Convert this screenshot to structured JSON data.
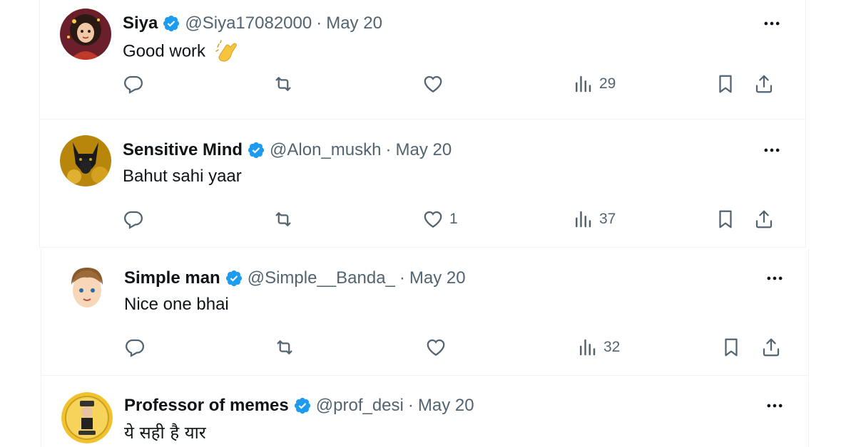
{
  "replies": [
    {
      "name": "Siya",
      "handle": "@Siya17082000",
      "separator": "·",
      "date": "May 20",
      "text": "Good work",
      "emoji": "clapping-hands",
      "likes": "",
      "views": "29"
    },
    {
      "name": "Sensitive Mind",
      "handle": "@Alon_muskh",
      "separator": "·",
      "date": "May 20",
      "text": "Bahut sahi yaar",
      "likes": "1",
      "views": "37"
    },
    {
      "name": "Simple man",
      "handle": "@Simple__Banda_",
      "separator": "·",
      "date": "May 20",
      "text": "Nice one bhai",
      "likes": "",
      "views": "32"
    },
    {
      "name": "Professor of memes",
      "handle": "@prof_desi",
      "separator": "·",
      "date": "May 20",
      "text": "ये सही है यार"
    }
  ],
  "colors": {
    "verified": "#1d9bf0",
    "secondary_text": "#536471",
    "primary_text": "#0f1419",
    "divider": "#eff3f4"
  }
}
